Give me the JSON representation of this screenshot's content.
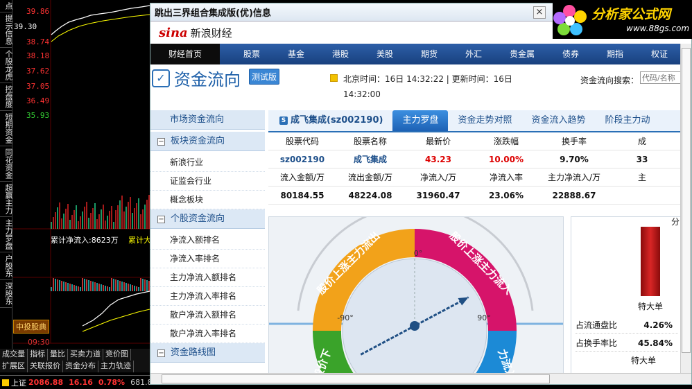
{
  "background_app": {
    "left_tabs": [
      "点",
      "提示信息",
      "个股龙虎",
      "控盘度",
      "短期资金",
      "同花资金",
      "超赢主力",
      "主力罗盘",
      "户股东",
      "深股东"
    ],
    "price_labels": [
      "39.86",
      "39.30",
      "38.74",
      "38.18",
      "37.62",
      "37.05",
      "36.49",
      "35.93"
    ],
    "chart_note": "累计净流入:8623万",
    "chart_note_2": "累计大",
    "highlight_label": "中投股典",
    "time_label": "09:30",
    "bottom_tabs_1": [
      "成交量",
      "指标",
      "量比",
      "买卖力道",
      "竞价图"
    ],
    "bottom_tabs_2": [
      "扩展区",
      "关联报价",
      "资金分布",
      "主力轨迹"
    ],
    "status": {
      "index_name": "上证",
      "index_value": "2086.88",
      "change": "16.16",
      "pct": "0.78%",
      "volume": "681.8"
    },
    "colors": {
      "up": "#ff3333",
      "label_yellow": "#ffff00"
    }
  },
  "popup": {
    "title": "跳出三界组合集成版(优)信息",
    "close_glyph": "×",
    "header": {
      "logo": "sina",
      "name": "新浪财经"
    },
    "nav": [
      "财经首页",
      "股票",
      "基金",
      "港股",
      "美股",
      "期货",
      "外汇",
      "贵金属",
      "债券",
      "期指",
      "权证"
    ],
    "section": {
      "icon": "chart-check-icon",
      "title": "资金流向",
      "badge": "测试版",
      "time_text": "北京时间：16日 14:32:22 | 更新时间：16日 14:32:00",
      "search_label": "资金流向搜索：",
      "search_placeholder": "代码/名称"
    },
    "sidebar": {
      "heads": [
        "市场资金流向",
        "板块资金流向",
        "个股资金流向",
        "资金路线图"
      ],
      "block_items": [
        "新浪行业",
        "证监会行业",
        "概念板块"
      ],
      "stock_items": [
        "净流入额排名",
        "净流入率排名",
        "主力净流入额排名",
        "主力净流入率排名",
        "散户净流入额排名",
        "散户净流入率排名"
      ]
    },
    "tabs": [
      "成飞集成(sz002190)",
      "主力罗盘",
      "资金走势对照",
      "资金流入趋势",
      "阶段主力动"
    ],
    "table": {
      "headers_1": [
        "股票代码",
        "股票名称",
        "最新价",
        "涨跌幅",
        "换手率",
        "成"
      ],
      "values_1": [
        "sz002190",
        "成飞集成",
        "43.23",
        "10.00%",
        "9.70%",
        "33"
      ],
      "headers_2": [
        "流入金额/万",
        "流出金额/万",
        "净流入/万",
        "净流入率",
        "主力净流入/万",
        "主"
      ],
      "values_2": [
        "80184.55",
        "48224.08",
        "31960.47",
        "23.06%",
        "22888.67",
        ""
      ]
    },
    "compass": {
      "labels": {
        "top_left": "股价上涨主力流出",
        "top_right": "股价上涨主力流入",
        "bottom_left": "股价下",
        "bottom_right": "力流入"
      },
      "ticks": {
        "zero": "0°",
        "neg90": "-90°",
        "pos90": "90°"
      },
      "needle_angle_deg": 62
    },
    "right_panel": {
      "top_label": "分",
      "bar_label": "特大单",
      "rows": [
        {
          "label": "占流通盘比",
          "value": "4.26%"
        },
        {
          "label": "占换手率比",
          "value": "45.84%"
        }
      ],
      "bottom_label": "特大单"
    }
  },
  "logo": {
    "text": "分析家公式网",
    "url_text": "www.88gs.com"
  }
}
